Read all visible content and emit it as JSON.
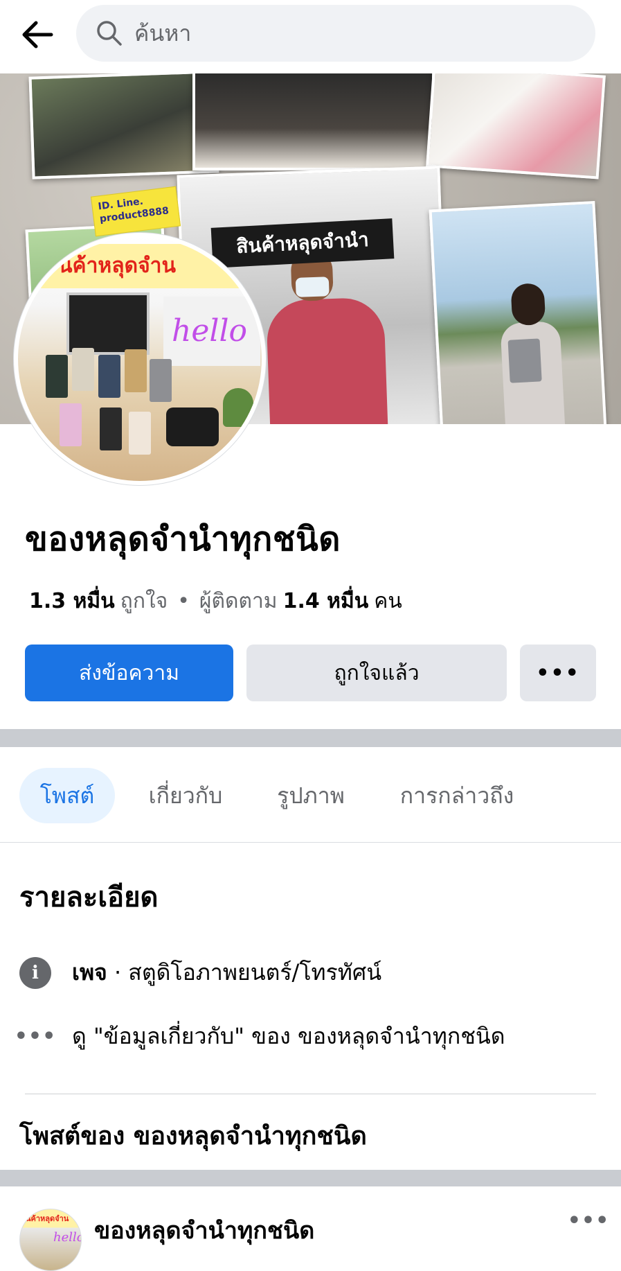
{
  "search": {
    "placeholder": "ค้นหา"
  },
  "cover": {
    "tag_line1": "ID. Line.",
    "tag_line2": "product8888",
    "shop_sign": "สินค้าหลุดจำนำ"
  },
  "avatar": {
    "banner": "นค้าหลุดจำน",
    "hello": "hello"
  },
  "page": {
    "name": "ของหลุดจำนำทุกชนิด",
    "likes_count": "1.3 หมื่น",
    "likes_label": "ถูกใจ",
    "separator": "•",
    "followers_label": "ผู้ติดตาม",
    "followers_count": "1.4 หมื่น",
    "followers_unit": "คน"
  },
  "actions": {
    "message": "ส่งข้อความ",
    "liked": "ถูกใจแล้ว",
    "more": "•••"
  },
  "tabs": [
    {
      "label": "โพสต์"
    },
    {
      "label": "เกี่ยวกับ"
    },
    {
      "label": "รูปภาพ"
    },
    {
      "label": "การกล่าวถึง"
    }
  ],
  "details": {
    "title": "รายละเอียด",
    "info_icon": "i",
    "category_strong": "เพจ",
    "category_rest": " · สตูดิโอภาพยนตร์/โทรทัศน์",
    "dots": "•••",
    "see_about": "ดู \"ข้อมูลเกี่ยวกับ\" ของ ของหลุดจำนำทุกชนิด"
  },
  "posts_section": {
    "title": "โพสต์ของ ของหลุดจำนำทุกชนิด"
  },
  "post": {
    "author": "ของหลุดจำนำทุกชนิด",
    "more": "•••"
  },
  "colors": {
    "primary_blue": "#1b74e4",
    "light_blue_bg": "#e7f3ff",
    "button_grey": "#e4e6eb",
    "muted_text": "#65676b",
    "divider_grey": "#c9ccd1"
  },
  "icons": [
    "back-arrow-icon",
    "search-icon",
    "info-icon",
    "more-dots-icon"
  ]
}
